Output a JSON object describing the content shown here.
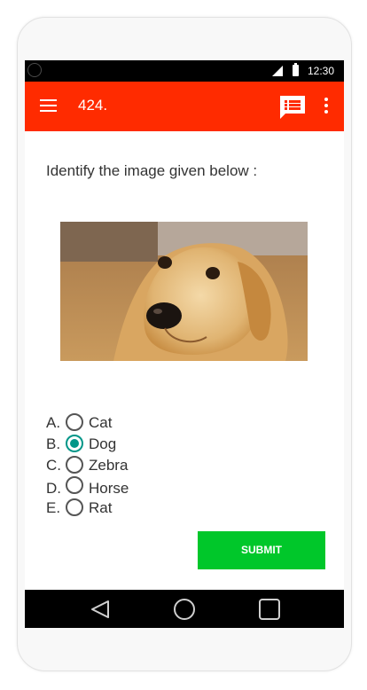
{
  "statusbar": {
    "time": "12:30"
  },
  "appbar": {
    "title": "424."
  },
  "question": {
    "text": "Identify the image given below :"
  },
  "options": [
    {
      "letter": "A.",
      "label": "Cat",
      "checked": false
    },
    {
      "letter": "B.",
      "label": "Dog",
      "checked": true
    },
    {
      "letter": "C.",
      "label": "Zebra",
      "checked": false
    },
    {
      "letter": "D.",
      "label": "Horse",
      "checked": false
    },
    {
      "letter": "E.",
      "label": "Rat",
      "checked": false
    }
  ],
  "submit": {
    "label": "SUBMIT"
  },
  "colors": {
    "appbar": "#ff2b00",
    "submit": "#00c72a",
    "radio_checked": "#009688"
  },
  "icons": [
    "menu-icon",
    "feedback-icon",
    "more-vert-icon",
    "back-icon",
    "home-icon",
    "recent-apps-icon"
  ]
}
